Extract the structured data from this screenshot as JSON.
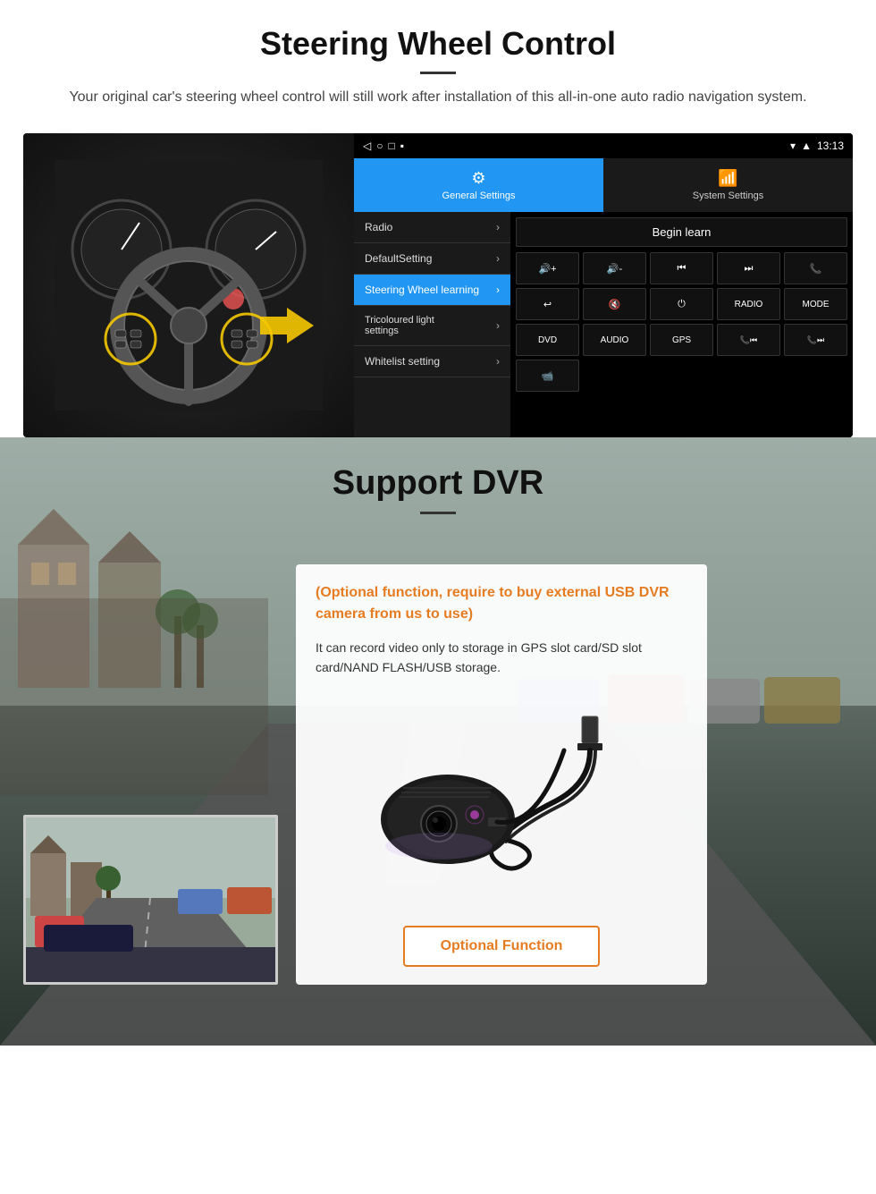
{
  "steering_section": {
    "title": "Steering Wheel Control",
    "subtitle": "Your original car's steering wheel control will still work after installation of this all-in-one auto radio navigation system.",
    "statusbar": {
      "time": "13:13",
      "icons": [
        "signal",
        "wifi",
        "battery"
      ]
    },
    "tabs": [
      {
        "label": "General Settings",
        "active": true,
        "icon": "⚙"
      },
      {
        "label": "System Settings",
        "active": false,
        "icon": "🔄"
      }
    ],
    "menu_items": [
      {
        "label": "Radio",
        "active": false
      },
      {
        "label": "DefaultSetting",
        "active": false
      },
      {
        "label": "Steering Wheel learning",
        "active": true
      },
      {
        "label": "Tricoloured light settings",
        "active": false
      },
      {
        "label": "Whitelist setting",
        "active": false
      }
    ],
    "begin_learn_label": "Begin learn",
    "control_buttons": [
      "🔊+",
      "🔊-",
      "⏮",
      "⏭",
      "📞",
      "↩",
      "🔇",
      "⏻",
      "RADIO",
      "MODE",
      "DVD",
      "AUDIO",
      "GPS",
      "📞⏮",
      "📞⏭",
      "📹"
    ]
  },
  "dvr_section": {
    "title": "Support DVR",
    "optional_text": "(Optional function, require to buy external USB DVR camera from us to use)",
    "description": "It can record video only to storage in GPS slot card/SD slot card/NAND FLASH/USB storage.",
    "optional_btn_label": "Optional Function"
  }
}
